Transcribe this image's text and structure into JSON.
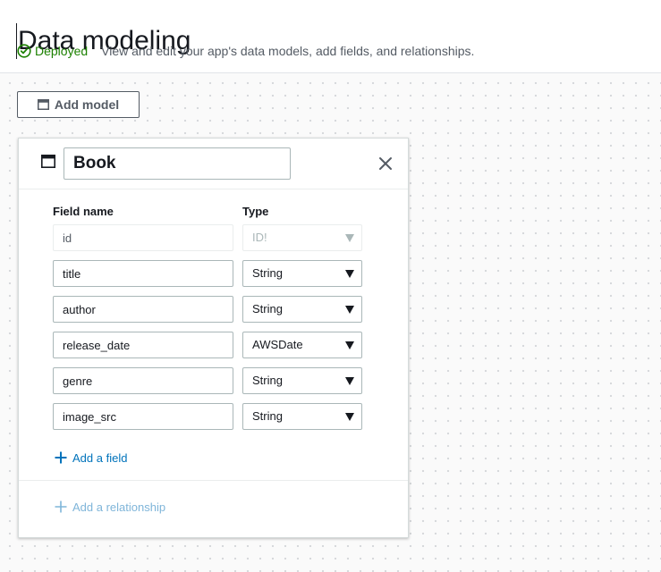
{
  "header": {
    "title": "Data modeling",
    "status": "Deployed",
    "description": "View and edit your app's data models, add fields, and relationships."
  },
  "toolbar": {
    "add_model_label": "Add model"
  },
  "model": {
    "name": "Book",
    "field_name_label": "Field name",
    "type_label": "Type",
    "fields": [
      {
        "name": "id",
        "type": "ID!"
      },
      {
        "name": "title",
        "type": "String"
      },
      {
        "name": "author",
        "type": "String"
      },
      {
        "name": "release_date",
        "type": "AWSDate"
      },
      {
        "name": "genre",
        "type": "String"
      },
      {
        "name": "image_src",
        "type": "String"
      }
    ],
    "add_field_label": "Add a field",
    "add_relationship_label": "Add a relationship"
  },
  "colors": {
    "success": "#1d8102",
    "link": "#0073bb",
    "link_disabled": "#7fb5d9"
  }
}
